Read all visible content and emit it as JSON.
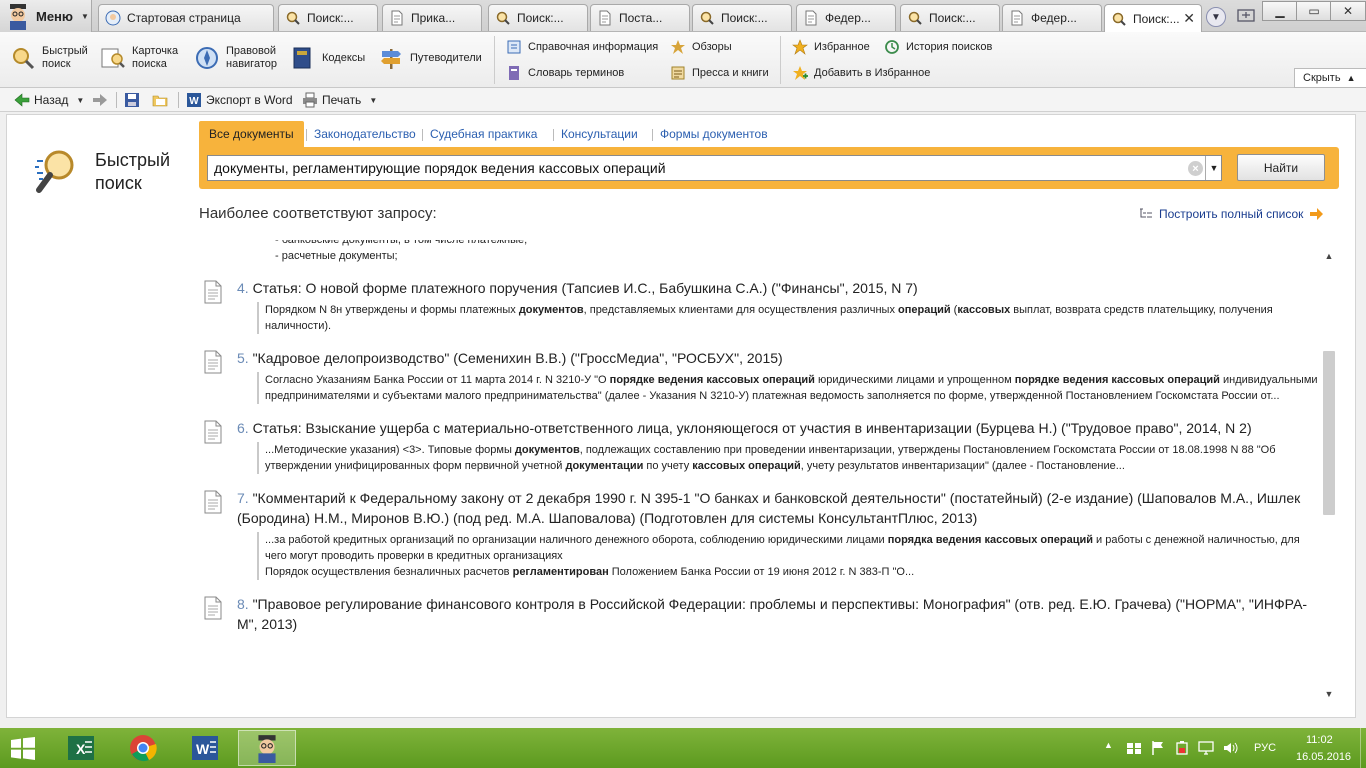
{
  "menu": {
    "label": "Меню"
  },
  "tabs": [
    {
      "label": "Стартовая страница",
      "icon": "consultant-icon"
    },
    {
      "label": "Поиск:...",
      "icon": "search-icon"
    },
    {
      "label": "Прика...",
      "icon": "document-icon"
    },
    {
      "label": "Поиск:...",
      "icon": "search-icon"
    },
    {
      "label": "Поста...",
      "icon": "document-icon"
    },
    {
      "label": "Поиск:...",
      "icon": "search-icon"
    },
    {
      "label": "Федер...",
      "icon": "document-icon"
    },
    {
      "label": "Поиск:...",
      "icon": "search-icon"
    },
    {
      "label": "Федер...",
      "icon": "document-icon"
    },
    {
      "label": "Поиск:...",
      "icon": "search-icon",
      "active": true
    }
  ],
  "ribbon": {
    "quick_search": "Быстрый\nпоиск",
    "search_card": "Карточка\nпоиска",
    "legal_navigator": "Правовой\nнавигатор",
    "codes": "Кодексы",
    "guides": "Путеводители",
    "reference_info": "Справочная информация",
    "reviews": "Обзоры",
    "glossary": "Словарь терминов",
    "press_books": "Пресса и книги",
    "favorites": "Избранное",
    "search_history": "История поисков",
    "add_favorites": "Добавить в Избранное",
    "collapse": "Скрыть"
  },
  "toolbar": {
    "back": "Назад",
    "export_word": "Экспорт в Word",
    "print": "Печать"
  },
  "quick_search_title": "Быстрый поиск",
  "search": {
    "tabs": [
      "Все документы",
      "Законодательство",
      "Судебная практика",
      "Консультации",
      "Формы документов"
    ],
    "active_tab": "Все документы",
    "query": "документы, регламентирующие порядок ведения кассовых операций",
    "find_button": "Найти"
  },
  "results_heading": "Наиболее соответствуют запросу:",
  "full_list_link": "Построить полный список",
  "results_prev": [
    "- банковские документы, в том числе платежные;",
    "- расчетные документы;"
  ],
  "results": [
    {
      "num": "4.",
      "title": "Статья: О новой форме платежного поручения (Тапсиев И.С., Бабушкина С.А.) (\"Финансы\", 2015, N 7)",
      "snippets": [
        [
          [
            "Порядком N 8н утверждены и формы платежных ",
            false
          ],
          [
            "документов",
            true
          ],
          [
            ", представляемых клиентами для осуществления различных ",
            false
          ],
          [
            "операций",
            true
          ],
          [
            " (",
            false
          ],
          [
            "кассовых",
            true
          ],
          [
            " выплат, возврата средств плательщику, получения наличности).",
            false
          ]
        ]
      ]
    },
    {
      "num": "5.",
      "title": "\"Кадровое делопроизводство\" (Семенихин В.В.) (\"ГроссМедиа\", \"РОСБУХ\", 2015)",
      "snippets": [
        [
          [
            "Согласно Указаниям Банка России от 11 марта 2014 г. N 3210-У \"О ",
            false
          ],
          [
            "порядке ведения кассовых операций",
            true
          ],
          [
            " юридическими лицами и упрощенном ",
            false
          ],
          [
            "порядке ведения кассовых операций",
            true
          ],
          [
            " индивидуальными предпринимателями и субъектами малого предпринимательства\" (далее - Указания N 3210-У) платежная ведомость заполняется по форме, утвержденной Постановлением Госкомстата России от...",
            false
          ]
        ]
      ]
    },
    {
      "num": "6.",
      "title": "Статья: Взыскание ущерба с материально-ответственного лица, уклоняющегося от участия в инвентаризации (Бурцева Н.) (\"Трудовое право\", 2014, N 2)",
      "snippets": [
        [
          [
            "...Методические указания) <3>. Типовые формы ",
            false
          ],
          [
            "документов",
            true
          ],
          [
            ", подлежащих составлению при проведении инвентаризации, утверждены Постановлением Госкомстата России от 18.08.1998 N 88 \"Об утверждении унифицированных форм первичной учетной ",
            false
          ],
          [
            "документации",
            true
          ],
          [
            " по учету ",
            false
          ],
          [
            "кассовых операций",
            true
          ],
          [
            ", учету результатов инвентаризации\" (далее - Постановление...",
            false
          ]
        ]
      ]
    },
    {
      "num": "7.",
      "title": "\"Комментарий к Федеральному закону от 2 декабря 1990 г. N 395-1 \"О банках и банковской деятельности\" (постатейный) (2-е издание) (Шаповалов М.А., Ишлек (Бородина) Н.М., Миронов В.Ю.) (под ред. М.А. Шаповалова) (Подготовлен для системы КонсультантПлюс, 2013)",
      "snippets": [
        [
          [
            "...за работой кредитных организаций по организации наличного денежного оборота, соблюдению юридическими лицами ",
            false
          ],
          [
            "порядка ведения кассовых операций",
            true
          ],
          [
            " и работы с денежной наличностью, для чего могут проводить проверки в кредитных организациях",
            false
          ]
        ],
        [
          [
            "Порядок осуществления безналичных расчетов ",
            false
          ],
          [
            "регламентирован",
            true
          ],
          [
            " Положением Банка России от 19 июня 2012 г. N 383-П \"О...",
            false
          ]
        ]
      ]
    },
    {
      "num": "8.",
      "title": "\"Правовое регулирование финансового контроля в Российской Федерации: проблемы и перспективы: Монография\" (отв. ред. Е.Ю. Грачева) (\"НОРМА\", \"ИНФРА-М\", 2013)",
      "snippets": []
    }
  ],
  "taskbar": {
    "lang": "РУС",
    "time": "11:02",
    "date": "16.05.2016"
  },
  "colors": {
    "accent": "#f7b33c",
    "link": "#2b5fb0",
    "taskbar": "#6aa52a"
  }
}
